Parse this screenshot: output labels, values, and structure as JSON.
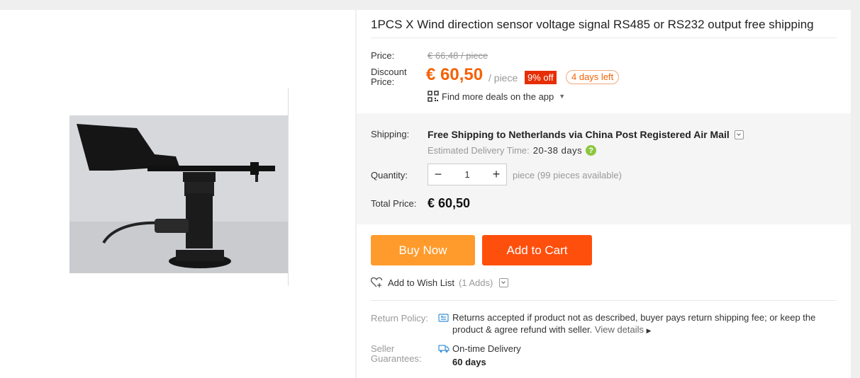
{
  "product": {
    "title": "1PCS X Wind direction sensor voltage signal RS485 or RS232 output free shipping",
    "image_alt": "wind-vane-sensor"
  },
  "price": {
    "label": "Price:",
    "original": "€ 66,48 / piece",
    "discount_label_1": "Discount",
    "discount_label_2": "Price:",
    "discount_value": "€ 60,50",
    "per_piece": "/ piece",
    "percent_off": "9% off",
    "days_left": "4 days left",
    "app_deals": "Find more deals on the app"
  },
  "shipping": {
    "label": "Shipping:",
    "free_text": "Free Shipping to Netherlands via China Post Registered Air Mail",
    "est_label": "Estimated Delivery Time:",
    "est_days": "20-38 days",
    "help_glyph": "?"
  },
  "quantity": {
    "label": "Quantity:",
    "value": "1",
    "minus": "−",
    "plus": "+",
    "note": "piece (99 pieces available)"
  },
  "total": {
    "label": "Total Price:",
    "value": "€ 60,50"
  },
  "actions": {
    "buy_now": "Buy Now",
    "add_to_cart": "Add to Cart",
    "wishlist": "Add to Wish List",
    "wishlist_adds": "(1 Adds)"
  },
  "return_policy": {
    "label": "Return Policy:",
    "text": "Returns accepted if product not as described, buyer pays return shipping fee; or keep the product & agree refund with seller.",
    "link": "View details"
  },
  "seller": {
    "label_1": "Seller",
    "label_2": "Guarantees:",
    "guarantee": "On-time Delivery",
    "days": "60 days"
  },
  "colors": {
    "accent_orange": "#f46206",
    "buy_now": "#ff9b2c",
    "add_to_cart": "#ff4f0c",
    "badge_red": "#e62e04",
    "help_green": "#8cc63f"
  }
}
